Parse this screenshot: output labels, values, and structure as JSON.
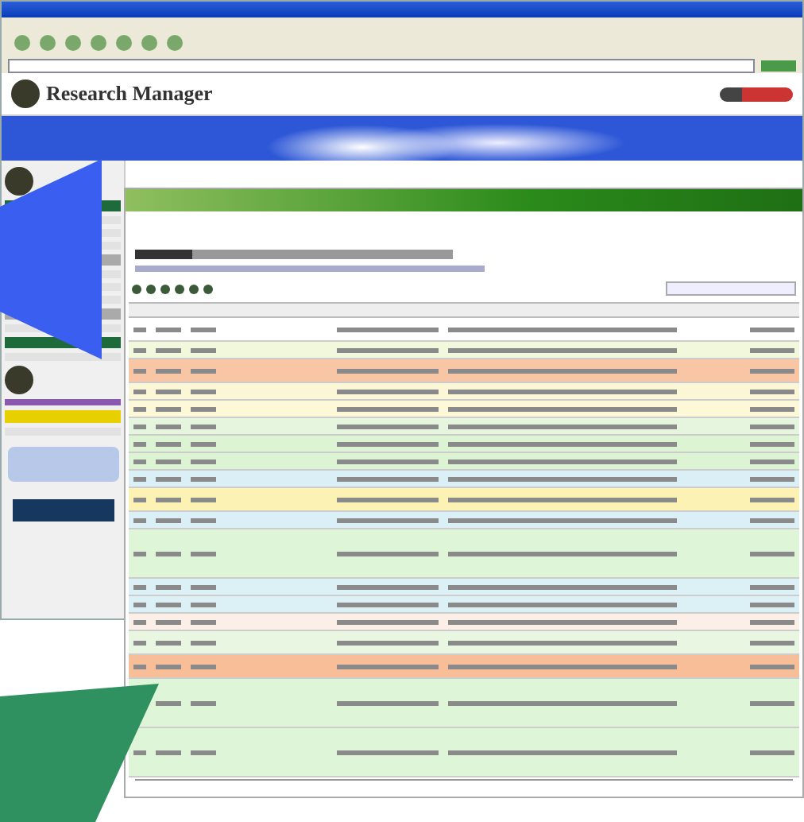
{
  "back_window": {
    "app_name": "Research Manager"
  },
  "table": {
    "rows": [
      {
        "color": "#ffffff",
        "kind": "double"
      },
      {
        "color": "#f2f8dc",
        "kind": "single"
      },
      {
        "color": "#f8c6a4",
        "kind": "double"
      },
      {
        "color": "#fbf6d6",
        "kind": "single"
      },
      {
        "color": "#fdf8d8",
        "kind": "single"
      },
      {
        "color": "#e6f6de",
        "kind": "single"
      },
      {
        "color": "#dcf3d4",
        "kind": "single"
      },
      {
        "color": "#dcf3d4",
        "kind": "single"
      },
      {
        "color": "#dbeff6",
        "kind": "single"
      },
      {
        "color": "#fbf2b4",
        "kind": "double"
      },
      {
        "color": "#dbeff6",
        "kind": "single"
      },
      {
        "color": "#dff5d8",
        "kind": "tall"
      },
      {
        "color": "#dbf1f6",
        "kind": "single"
      },
      {
        "color": "#dbf1f6",
        "kind": "single"
      },
      {
        "color": "#fcefe8",
        "kind": "single"
      },
      {
        "color": "#e8f6e2",
        "kind": "double"
      },
      {
        "color": "#f8be98",
        "kind": "double"
      },
      {
        "color": "#dff5d8",
        "kind": "tall"
      },
      {
        "color": "#dff5d8",
        "kind": "tall"
      }
    ]
  }
}
